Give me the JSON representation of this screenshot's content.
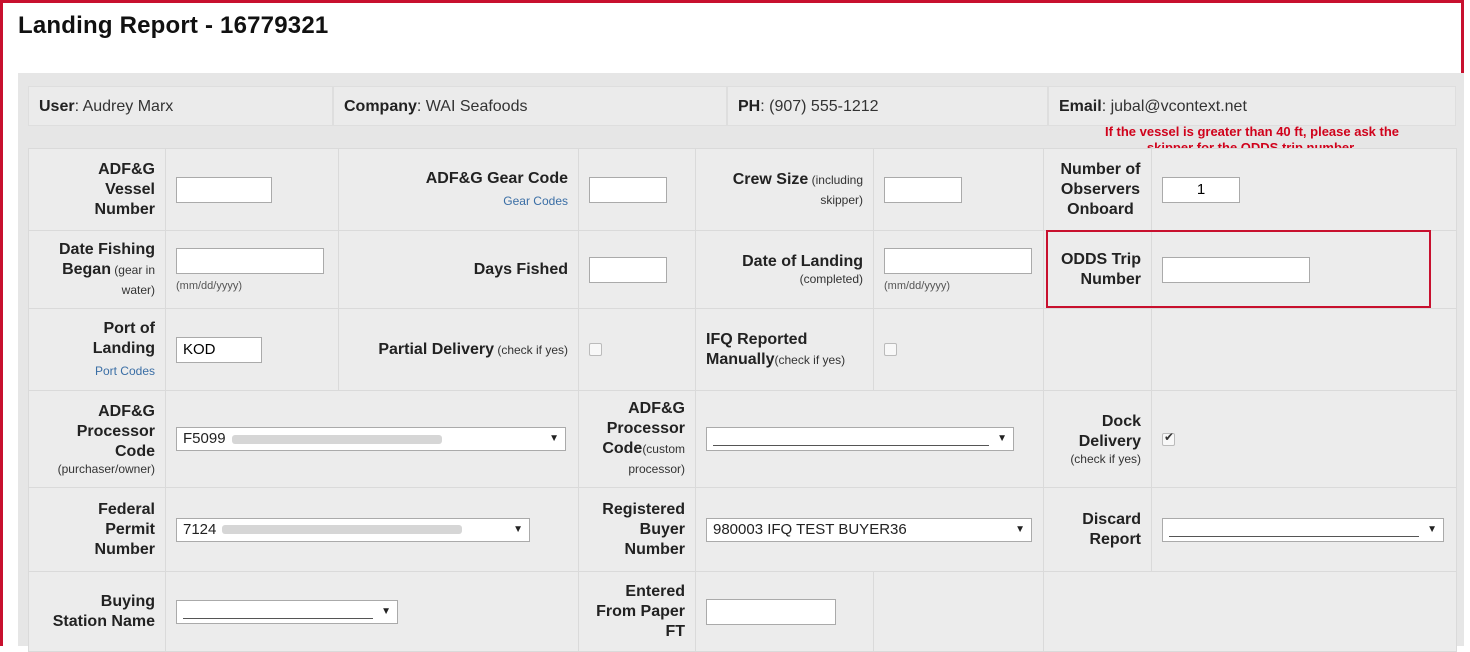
{
  "page": {
    "title": "Landing Report - 16779321"
  },
  "info": {
    "user_label": "User",
    "user_value": ": Audrey Marx",
    "company_label": "Company",
    "company_value": ": WAI Seafoods",
    "phone_label": "PH",
    "phone_value": ": (907) 555-1212",
    "email_label": "Email",
    "email_value": ": jubal@vcontext.net"
  },
  "warning": {
    "line1": "If the vessel is greater than 40 ft, please ask the",
    "line2": "skipper for the ODDS trip number."
  },
  "form": {
    "vessel_l1": "ADF&G",
    "vessel_l2": "Vessel",
    "vessel_l3": "Number",
    "vessel_value": "",
    "gear_label": "ADF&G Gear Code",
    "gear_link": "Gear Codes",
    "gear_value": "",
    "crew_label": "Crew Size",
    "crew_sub": " (including skipper)",
    "crew_value": "",
    "observers_l1": "Number of",
    "observers_l2": "Observers",
    "observers_l3": "Onboard",
    "observers_value": "1",
    "date_began_l1": "Date Fishing",
    "date_began_l2": "Began",
    "date_began_sub": " (gear in water)",
    "date_began_value": "",
    "date_hint": "(mm/dd/yyyy)",
    "days_fished_label": "Days Fished",
    "days_fished_value": "",
    "date_landing_label": "Date of Landing",
    "date_landing_sub": "(completed)",
    "date_landing_value": "",
    "odds_l1": "ODDS Trip",
    "odds_l2": "Number",
    "odds_value": "",
    "port_l1": "Port of",
    "port_l2": "Landing",
    "port_link": "Port Codes",
    "port_value": "KOD",
    "partial_label": "Partial Delivery",
    "partial_sub": " (check if yes)",
    "ifq_l1": "IFQ Reported",
    "ifq_l2": "Manually",
    "ifq_sub": "(check if yes)",
    "proc_l1": "ADF&G",
    "proc_l2": "Processor",
    "proc_l3": "Code",
    "proc_sub": "(purchaser/owner)",
    "proc_value": "F5099",
    "cproc_l1": "ADF&G",
    "cproc_l2": "Processor",
    "cproc_l3": "Code",
    "cproc_sub": "(custom processor)",
    "dock_l1": "Dock",
    "dock_l2": "Delivery",
    "dock_sub": "(check if yes)",
    "permit_l1": "Federal",
    "permit_l2": "Permit",
    "permit_l3": "Number",
    "permit_value": "7124",
    "buyer_l1": "Registered",
    "buyer_l2": "Buyer",
    "buyer_l3": "Number",
    "buyer_value": "980003 IFQ TEST BUYER36",
    "discard_l1": "Discard",
    "discard_l2": "Report",
    "station_l1": "Buying",
    "station_l2": "Station Name",
    "paper_l1": "Entered",
    "paper_l2": "From Paper",
    "paper_l3": "FT",
    "paper_value": ""
  },
  "colors": {
    "accent_red": "#c8102e",
    "link_blue": "#3a6ea5"
  }
}
